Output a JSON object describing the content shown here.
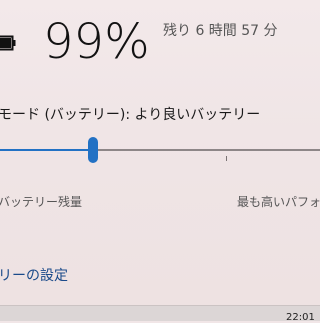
{
  "battery": {
    "icon": "battery-icon",
    "percent_text": "99%",
    "remaining_text": "残り 6 時間 57 分"
  },
  "power_mode": {
    "label": "モード (バッテリー): より良いバッテリー",
    "level": 0.29,
    "left_label": "バッテリー残量",
    "right_label": "最も高いパフォ",
    "accent_color": "#2271c4"
  },
  "settings_link": {
    "label": "リーの設定"
  },
  "taskbar": {
    "clock": "22:01"
  }
}
